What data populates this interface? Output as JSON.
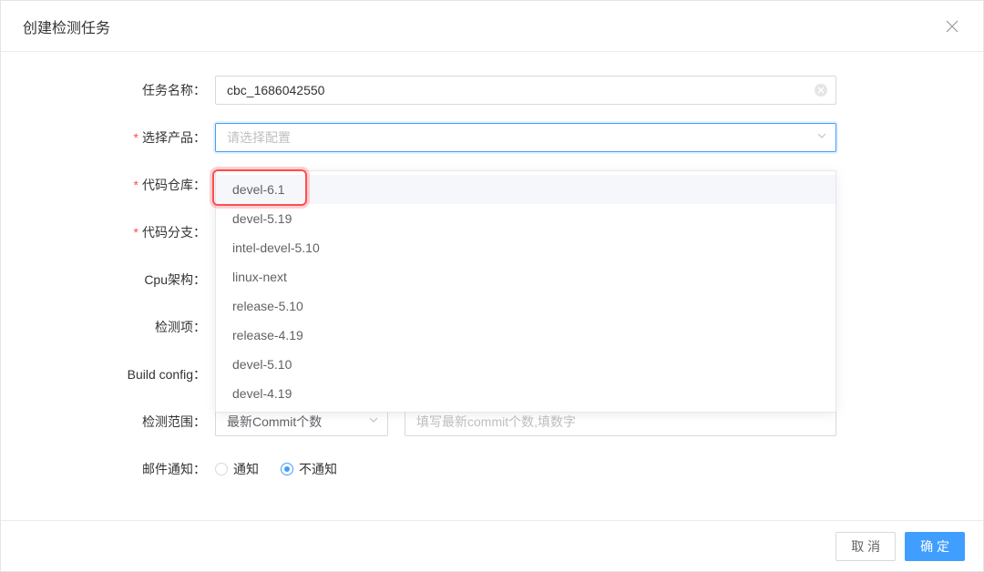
{
  "modal": {
    "title": "创建检测任务"
  },
  "form": {
    "task_name": {
      "label": "任务名称：",
      "value": "cbc_1686042550"
    },
    "product": {
      "label": "选择产品：",
      "placeholder": "请选择配置"
    },
    "repo": {
      "label": "代码仓库："
    },
    "branch": {
      "label": "代码分支："
    },
    "cpu": {
      "label": "Cpu架构："
    },
    "check": {
      "label": "检测项："
    },
    "build": {
      "label": "Build config："
    },
    "range": {
      "label": "检测范围：",
      "select_value": "最新Commit个数",
      "input_placeholder": "填写最新commit个数,填数字"
    },
    "mail": {
      "label": "邮件通知：",
      "options": {
        "yes": "通知",
        "no": "不通知"
      },
      "selected": "no"
    }
  },
  "dropdown": {
    "items": [
      "devel-6.1",
      "devel-5.19",
      "intel-devel-5.10",
      "linux-next",
      "release-5.10",
      "release-4.19",
      "devel-5.10",
      "devel-4.19"
    ],
    "hovered_index": 0
  },
  "footer": {
    "cancel": "取 消",
    "confirm": "确 定"
  }
}
